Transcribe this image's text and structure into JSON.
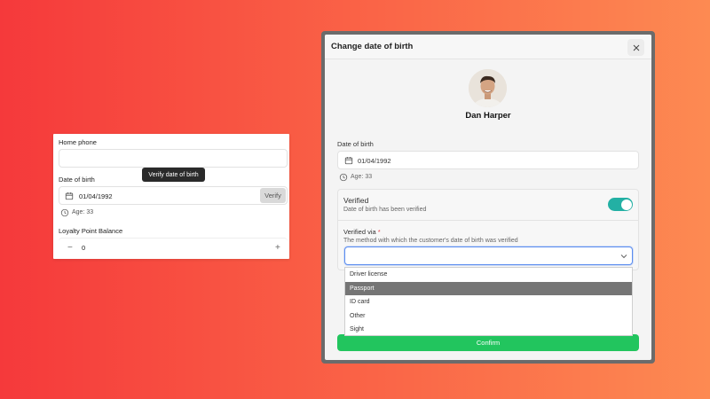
{
  "left_panel": {
    "home_phone_label": "Home phone",
    "home_phone_value": "",
    "dob_label": "Date of birth",
    "dob_value": "01/04/1992",
    "verify_button": "Verify",
    "tooltip": "Verify date of birth",
    "age_text": "Age: 33",
    "loyalty_label": "Loyalty Point Balance",
    "loyalty_value": "0",
    "minus_icon": "minus-icon",
    "plus_icon": "plus-icon"
  },
  "modal": {
    "title": "Change date of birth",
    "close_icon": "close-icon",
    "user_name": "Dan Harper",
    "dob_label": "Date of birth",
    "dob_value": "01/04/1992",
    "age_text": "Age: 33",
    "verified_title": "Verified",
    "verified_subtitle": "Date of birth has been verified",
    "verified_on": true,
    "verified_via_label": "Verified via",
    "required_marker": "*",
    "verified_via_help": "The method with which the customer's date of birth was verified",
    "select_value": "",
    "options": [
      {
        "label": "Driver license",
        "selected": false
      },
      {
        "label": "Passport",
        "selected": true
      },
      {
        "label": "ID card",
        "selected": false
      },
      {
        "label": "Other",
        "selected": false
      },
      {
        "label": "Sight",
        "selected": false
      }
    ],
    "confirm_button": "Confirm"
  },
  "colors": {
    "accent_green": "#22c55e",
    "toggle_teal": "#23b0a4",
    "focus_blue": "#5b8def",
    "required_red": "#e5484d"
  }
}
